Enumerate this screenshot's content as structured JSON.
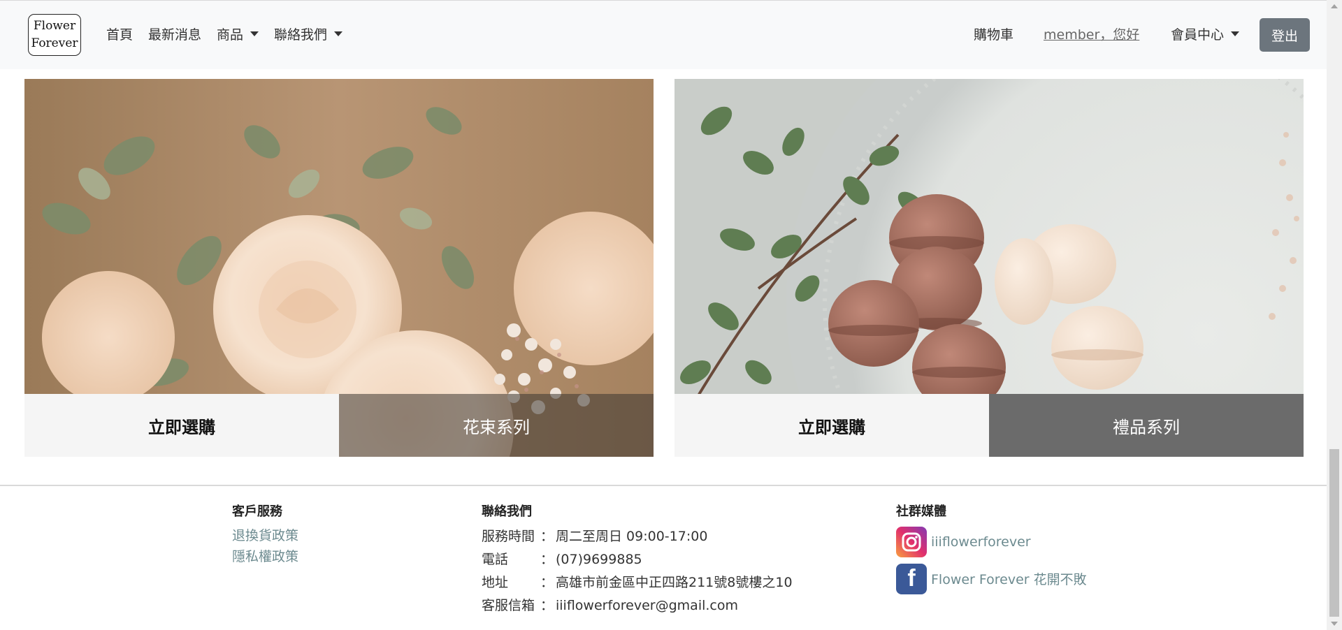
{
  "navbar": {
    "logo_line1": "Flower",
    "logo_line2": "Forever",
    "items": [
      {
        "label": "首頁",
        "has_caret": false
      },
      {
        "label": "最新消息",
        "has_caret": false
      },
      {
        "label": "商品",
        "has_caret": true
      },
      {
        "label": "聯絡我們",
        "has_caret": true
      }
    ],
    "cart": "購物車",
    "member_greeting": "member，您好",
    "member_center": "會員中心",
    "logout": "登出"
  },
  "products": [
    {
      "buy_label": "立即選購",
      "series_label": "花束系列",
      "image": "flower-bouquet-photo"
    },
    {
      "buy_label": "立即選購",
      "series_label": "禮品系列",
      "image": "macarons-photo"
    }
  ],
  "footer": {
    "service": {
      "title": "客戶服務",
      "links": [
        "退換貨政策",
        "隱私權政策"
      ]
    },
    "contact": {
      "title": "聯絡我們",
      "rows": [
        {
          "key": "服務時間",
          "sep": "：",
          "value": "周二至周日 09:00-17:00"
        },
        {
          "key": "電話",
          "sep": "：",
          "value": "(07)9699885"
        },
        {
          "key": "地址",
          "sep": "：",
          "value": "高雄市前金區中正四路211號8號樓之10"
        },
        {
          "key": "客服信箱",
          "sep": "：",
          "value": "iiiflowerforever@gmail.com"
        }
      ]
    },
    "social": {
      "title": "社群媒體",
      "instagram": "iiiflowerforever",
      "facebook": "Flower Forever 花開不敗"
    }
  },
  "colors": {
    "navbar_bg": "#f8f9fa",
    "logout_bg": "#6c757d",
    "link": "#6c8a8f",
    "gift_series_bg": "#6b6b6b"
  }
}
